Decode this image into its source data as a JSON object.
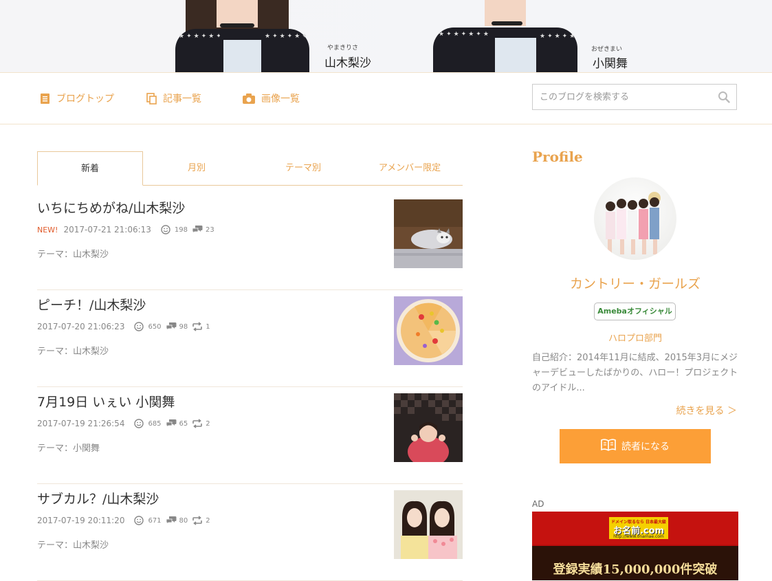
{
  "banner": {
    "members": [
      {
        "kana": "やまきりさ",
        "name": "山木梨沙"
      },
      {
        "kana": "おぜきまい",
        "name": "小関舞"
      }
    ]
  },
  "nav": {
    "items": [
      {
        "label": "ブログトップ",
        "icon": "document-icon"
      },
      {
        "label": "記事一覧",
        "icon": "copy-icon"
      },
      {
        "label": "画像一覧",
        "icon": "camera-icon"
      }
    ],
    "search_placeholder": "このブログを検索する"
  },
  "tabs": [
    "新着",
    "月別",
    "テーマ別",
    "アメンバー限定"
  ],
  "entries": [
    {
      "title": "いちにちめがね/山木梨沙",
      "new": "NEW!",
      "date": "2017-07-21 21:06:13",
      "likes": "198",
      "comments": "23",
      "reblogs": "",
      "theme": "テーマ：山木梨沙"
    },
    {
      "title": "ピーチ！/山木梨沙",
      "new": "",
      "date": "2017-07-20 21:06:23",
      "likes": "650",
      "comments": "98",
      "reblogs": "1",
      "theme": "テーマ：山木梨沙"
    },
    {
      "title": "7月19日 いぇい 小関舞",
      "new": "",
      "date": "2017-07-19 21:26:54",
      "likes": "685",
      "comments": "65",
      "reblogs": "2",
      "theme": "テーマ：小関舞"
    },
    {
      "title": "サブカル？/山木梨沙",
      "new": "",
      "date": "2017-07-19 20:11:20",
      "likes": "671",
      "comments": "80",
      "reblogs": "2",
      "theme": "テーマ：山木梨沙"
    }
  ],
  "profile": {
    "heading": "Profile",
    "name": "カントリー・ガールズ",
    "badge": "Amebaオフィシャル",
    "category": "ハロプロ部門",
    "intro": "自己紹介：2014年11月に結成、2015年3月にメジャーデビューしたばかりの、ハロー！プロジェクトのアイドル...",
    "more": "続きを見る ＞",
    "follow": "読者になる"
  },
  "ad": {
    "label": "AD",
    "small": "ドメイン取るなら 日本最大級",
    "logo": "お名前.com",
    "url": "http://www.onamae.com",
    "headline": "登録実績15,000,000件突破"
  },
  "colors": {
    "accent": "#e9a34e",
    "button": "#fc9f37",
    "new": "#e05a2a"
  }
}
